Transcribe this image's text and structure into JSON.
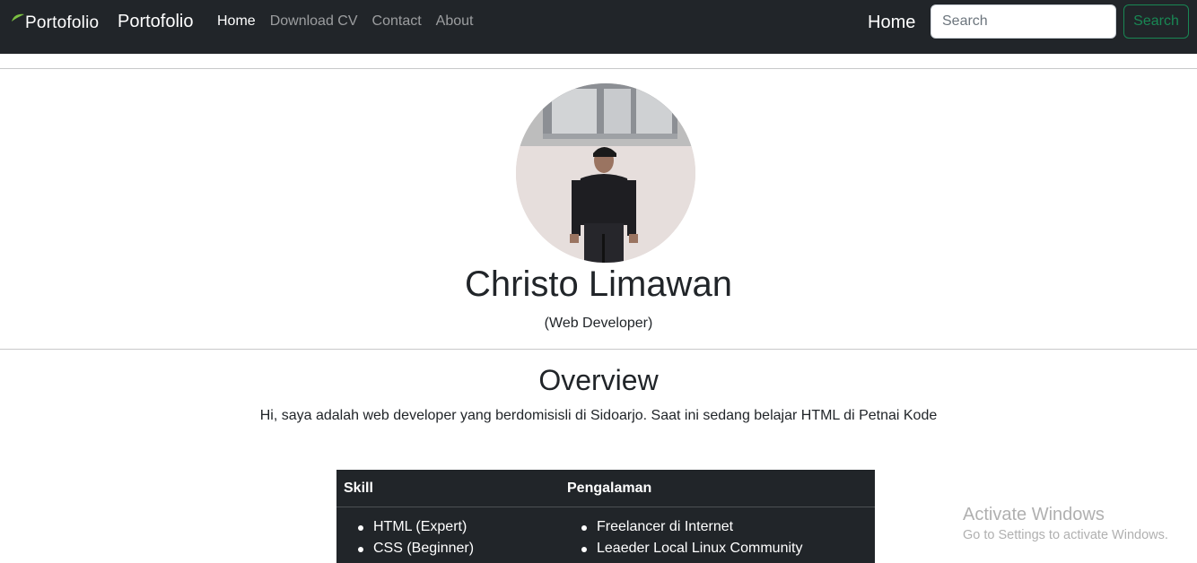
{
  "navbar": {
    "logo_text": "Portofolio",
    "brand": "Portofolio",
    "links": [
      {
        "label": "Home",
        "active": true
      },
      {
        "label": "Download CV",
        "active": false
      },
      {
        "label": "Contact",
        "active": false
      },
      {
        "label": "About",
        "active": false
      }
    ],
    "right_home": "Home",
    "search": {
      "placeholder": "Search",
      "button_label": "Search"
    }
  },
  "profile": {
    "name": "Christo Limawan",
    "role": "(Web Developer)"
  },
  "overview": {
    "title": "Overview",
    "text": "Hi, saya adalah web developer yang berdomisisli di Sidoarjo. Saat ini sedang belajar HTML di Petnai Kode"
  },
  "table": {
    "headers": [
      "Skill",
      "Pengalaman"
    ],
    "skills": [
      "HTML (Expert)",
      "CSS (Beginner)"
    ],
    "experience": [
      "Freelancer di Internet",
      "Leaeder Local Linux Community"
    ]
  },
  "watermark": {
    "title": "Activate Windows",
    "subtitle": "Go to Settings to activate Windows."
  },
  "colors": {
    "navbar_bg": "#212529",
    "success": "#198754",
    "table_bg": "#212529"
  }
}
